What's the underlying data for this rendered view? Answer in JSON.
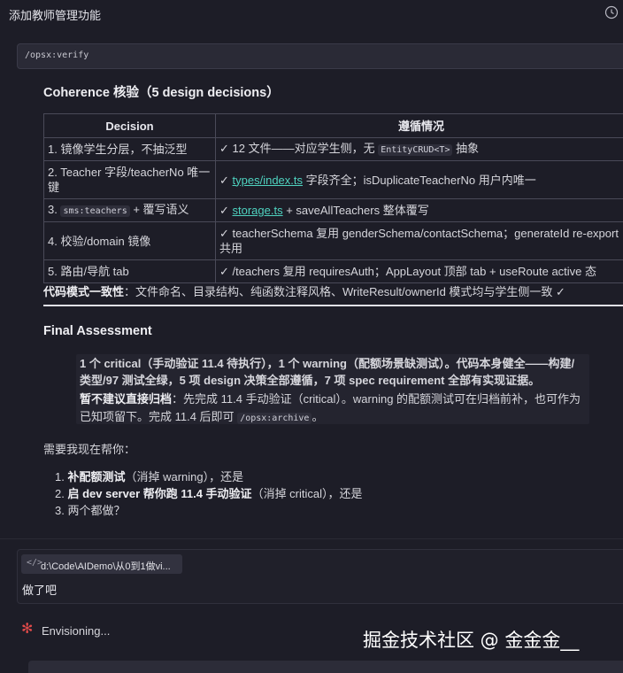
{
  "window": {
    "title": "添加教师管理功能",
    "history_icon": "clock-icon"
  },
  "command": {
    "text": "/opsx:verify"
  },
  "coherence": {
    "heading": "Coherence 核验（5 design decisions）",
    "headers": [
      "Decision",
      "遵循情况"
    ],
    "rows": [
      {
        "d_text": "1. 镜像学生分层，不抽泛型",
        "c_pre": "✓ 12 文件——对应学生侧，无 ",
        "c_code": "EntityCRUD<T>",
        "c_post": " 抽象"
      },
      {
        "d_text": "2. Teacher 字段/teacherNo 唯一键",
        "c_link": "types/index.ts",
        "c_post": " 字段齐全；isDuplicateTeacherNo 用户内唯一"
      },
      {
        "d_pre": "3. ",
        "d_code": "sms:teachers",
        "d_post": " + 覆写语义",
        "c_link": "storage.ts",
        "c_post": " + saveAllTeachers 整体覆写"
      },
      {
        "d_text": "4. 校验/domain 镜像",
        "c_text": "✓ teacherSchema 复用 genderSchema/contactSchema；generateId re-export 共用"
      },
      {
        "d_text": "5. 路由/导航 tab",
        "c_text": "✓ /teachers 复用 requiresAuth；AppLayout 顶部 tab + useRoute active 态"
      }
    ],
    "check_prefix": "✓ ",
    "consistency_label": "代码模式一致性",
    "consistency_text": "：文件命名、目录结构、纯函数注释风格、WriteResult/ownerId 模式均与学生侧一致 ✓"
  },
  "final": {
    "heading": "Final Assessment",
    "line1": "1 个 critical（手动验证 11.4 待执行），1 个 warning（配额场景缺测试）。代码本身健全——构建/",
    "line2": "类型/97 测试全绿，5 项 design 决策全部遵循，7 项 spec requirement 全部有实现证据。",
    "line3_bold": "暂不建议直接归档",
    "line3_rest": "：先完成 11.4 手动验证（critical）。warning 的配额测试可在归档前补，也可作为",
    "line4_pre": "已知项留下。完成 11.4 后即可 ",
    "line4_code": "/opsx:archive",
    "line4_post": "。"
  },
  "ask": {
    "prompt": "需要我现在帮你：",
    "options": [
      {
        "num": "1. ",
        "bold": "补配额测试",
        "rest": "（消掉 warning），还是"
      },
      {
        "num": "2. ",
        "bold": "启 dev server 帮你跑 11.4 手动验证",
        "rest": "（消掉 critical），还是"
      },
      {
        "num": "3. ",
        "bold": "",
        "rest": "两个都做？"
      }
    ]
  },
  "user": {
    "path_icon": "</>",
    "path": "d:\\Code\\AIDemo\\从0到1做vi...",
    "message": "做了吧"
  },
  "status": {
    "text": "Envisioning...",
    "icon": "asterisk-icon",
    "icon_color": "#e04a4a"
  },
  "watermark": "掘金技术社区 @ 金金金__"
}
